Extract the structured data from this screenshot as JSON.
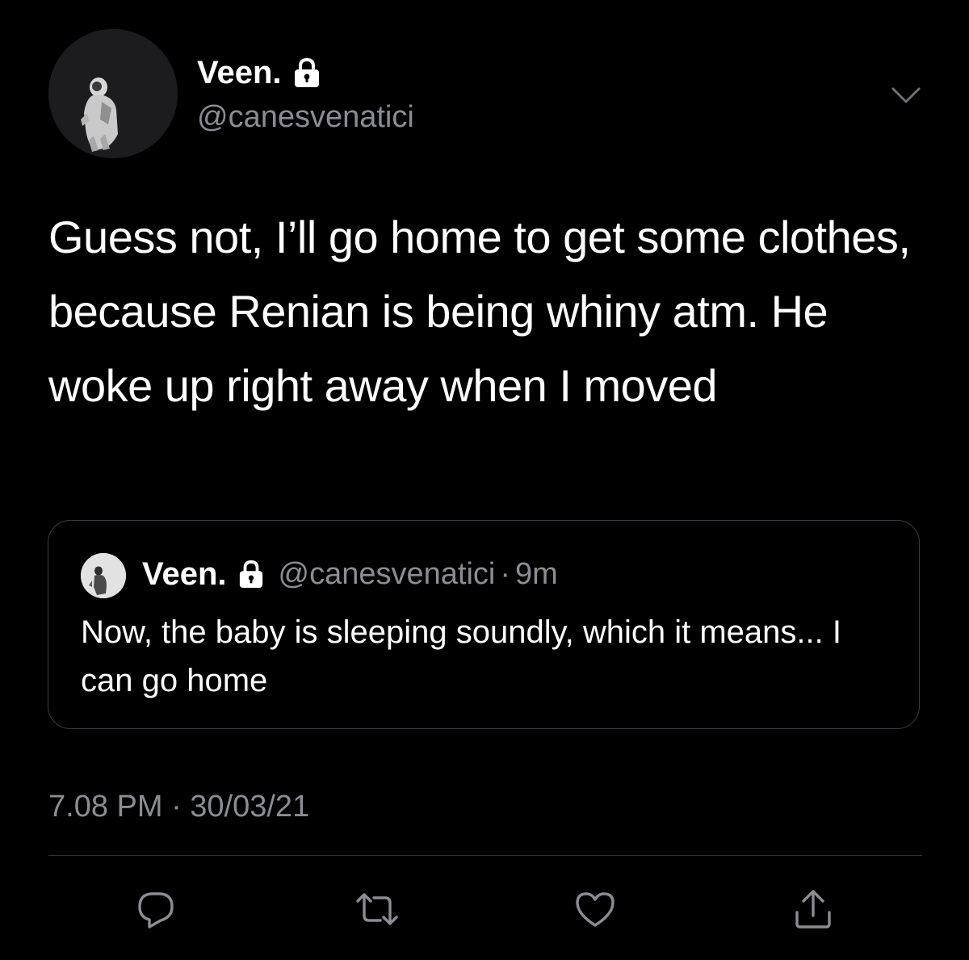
{
  "author": {
    "display_name": "Veen.",
    "handle": "@canesvenatici",
    "verified_icon": "lock-icon",
    "avatar_icon": "astronaut-avatar"
  },
  "tweet": {
    "text": "Guess not, I’ll go home to get some clothes, because Renian is being whiny atm. He woke up right away when I moved",
    "timestamp": "7.08 PM · 30/03/21"
  },
  "quoted_tweet": {
    "display_name": "Veen.",
    "handle": "@canesvenatici",
    "separator": "·",
    "age": "9m",
    "text": "Now, the baby is sleeping soundly, which it means... I can go home"
  },
  "actions": {
    "reply_icon": "reply-icon",
    "retweet_icon": "retweet-icon",
    "like_icon": "heart-icon",
    "share_icon": "share-icon"
  },
  "colors": {
    "background": "#000000",
    "primary_text": "#ffffff",
    "secondary_text": "#8b8d92",
    "border": "#3b3d42"
  }
}
